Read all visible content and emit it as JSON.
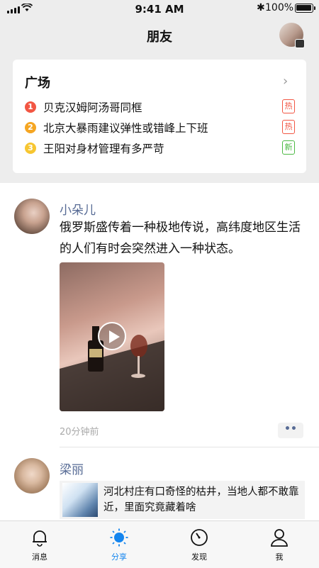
{
  "status_bar": {
    "time": "9:41 AM",
    "battery": "100%"
  },
  "header": {
    "title": "朋友"
  },
  "square": {
    "title": "广场",
    "items": [
      {
        "rank": "1",
        "text": "贝克汉姆阿汤哥同框",
        "badge": "热",
        "rank_color": "#f25643",
        "badge_color": "#f25643"
      },
      {
        "rank": "2",
        "text": "北京大暴雨建议弹性或错峰上下班",
        "badge": "热",
        "rank_color": "#f5a623",
        "badge_color": "#f25643"
      },
      {
        "rank": "3",
        "text": "王阳对身材管理有多严苛",
        "badge": "新",
        "rank_color": "#f7c631",
        "badge_color": "#4cb944"
      }
    ]
  },
  "feed": {
    "posts": [
      {
        "name": "小朵儿",
        "text": "俄罗斯盛传着一种极地传说，高纬度地区生活的人们有时会突然进入一种状态。",
        "time": "20分钟前"
      },
      {
        "name": "梁丽",
        "share_text": "河北村庄有口奇怪的枯井，当地人都不敢靠近，里面究竟藏着啥"
      }
    ]
  },
  "tabbar": {
    "tabs": [
      {
        "label": "消息"
      },
      {
        "label": "分享"
      },
      {
        "label": "发现"
      },
      {
        "label": "我"
      }
    ],
    "active": "分享",
    "accent": "#1485ee"
  }
}
